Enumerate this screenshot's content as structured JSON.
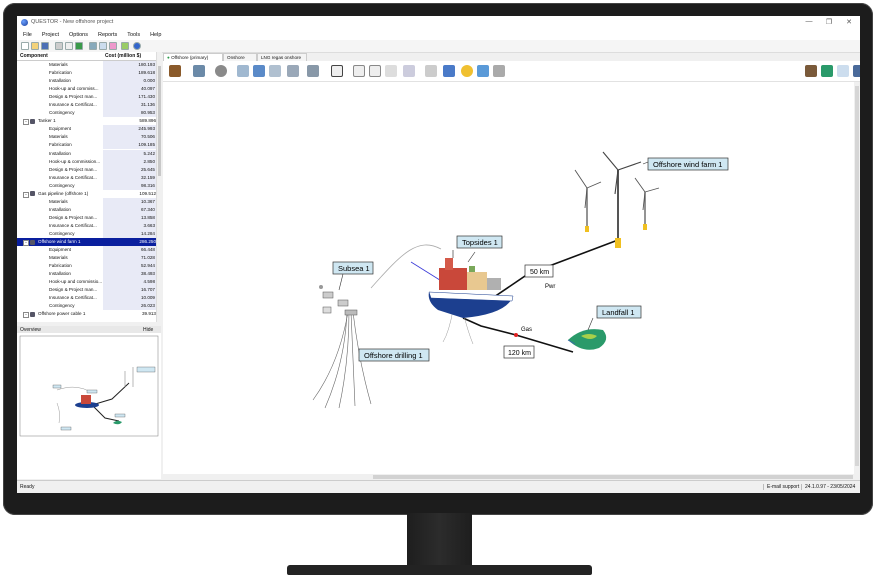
{
  "window": {
    "title": "QUESTOR - New offshore project",
    "minimize": "—",
    "restore": "❐",
    "close": "✕"
  },
  "menu": [
    "File",
    "Project",
    "Options",
    "Reports",
    "Tools",
    "Help"
  ],
  "tree": {
    "col_component": "Component",
    "col_cost": "Cost (million $)",
    "rows": [
      {
        "label": "Materials",
        "value": "180.193",
        "type": "child"
      },
      {
        "label": "Fabrication",
        "value": "189.618",
        "type": "child"
      },
      {
        "label": "Installation",
        "value": "0.000",
        "type": "child"
      },
      {
        "label": "Hook-up and commiss...",
        "value": "40.097",
        "type": "child"
      },
      {
        "label": "Design & Project man...",
        "value": "171.430",
        "type": "child"
      },
      {
        "label": "Insurance & Certificat...",
        "value": "31.136",
        "type": "child"
      },
      {
        "label": "Contingency",
        "value": "80.953",
        "type": "child"
      },
      {
        "label": "Tanker  1",
        "value": "589.896",
        "type": "parent"
      },
      {
        "label": "Equipment",
        "value": "245.993",
        "type": "child"
      },
      {
        "label": "Materials",
        "value": "70.506",
        "type": "child"
      },
      {
        "label": "Fabrication",
        "value": "109.185",
        "type": "child"
      },
      {
        "label": "Installation",
        "value": "5.242",
        "type": "child"
      },
      {
        "label": "Hook-up & commission...",
        "value": "2.850",
        "type": "child"
      },
      {
        "label": "Design & Project man...",
        "value": "25.645",
        "type": "child"
      },
      {
        "label": "Insurance & Certificat...",
        "value": "32.159",
        "type": "child"
      },
      {
        "label": "Contingency",
        "value": "98.316",
        "type": "child"
      },
      {
        "label": "Gas pipeline (offshore  1)",
        "value": "109.512",
        "type": "parent"
      },
      {
        "label": "Materials",
        "value": "10.367",
        "type": "child"
      },
      {
        "label": "Installation",
        "value": "67.340",
        "type": "child"
      },
      {
        "label": "Design & Project man...",
        "value": "13.858",
        "type": "child"
      },
      {
        "label": "Insurance & Certificat...",
        "value": "3.663",
        "type": "child"
      },
      {
        "label": "Contingency",
        "value": "14.284",
        "type": "child"
      },
      {
        "label": "Offshore wind farm  1",
        "value": "286.250",
        "type": "parent",
        "selected": true
      },
      {
        "label": "Equipment",
        "value": "66.448",
        "type": "child"
      },
      {
        "label": "Materials",
        "value": "71.028",
        "type": "child"
      },
      {
        "label": "Fabrication",
        "value": "52.944",
        "type": "child"
      },
      {
        "label": "Installation",
        "value": "38.493",
        "type": "child"
      },
      {
        "label": "Hook-up and commissio...",
        "value": "4.598",
        "type": "child"
      },
      {
        "label": "Design & Project man...",
        "value": "16.707",
        "type": "child"
      },
      {
        "label": "Insurance & Certificat...",
        "value": "10.009",
        "type": "child"
      },
      {
        "label": "Contingency",
        "value": "26.023",
        "type": "child"
      },
      {
        "label": "Offshore power cable  1",
        "value": "39.913",
        "type": "parent"
      }
    ]
  },
  "overview": {
    "title": "Overview",
    "hide": "Hide"
  },
  "tabs": [
    {
      "label": "Offshore (primary)",
      "active": true
    },
    {
      "label": "Onshore",
      "active": false
    },
    {
      "label": "LNG regas onshore",
      "active": false
    }
  ],
  "canvas": {
    "wind_farm": "Offshore wind farm  1",
    "topsides": "Topsides  1",
    "subsea": "Subsea  1",
    "landfall": "Landfall  1",
    "drilling": "Offshore drilling  1",
    "cable_length": "50 km",
    "cable_tag": "Pwr",
    "pipeline_length": "120 km",
    "pipeline_tag": "Gas"
  },
  "status": {
    "left": "Ready",
    "support": "E-mail support",
    "version": "24.1.0.97 - 23/05/2024"
  },
  "colors": {
    "selection": "#0a1f9e",
    "label_fill": "#cfe7f2",
    "hull_blue": "#1c3f8f"
  }
}
